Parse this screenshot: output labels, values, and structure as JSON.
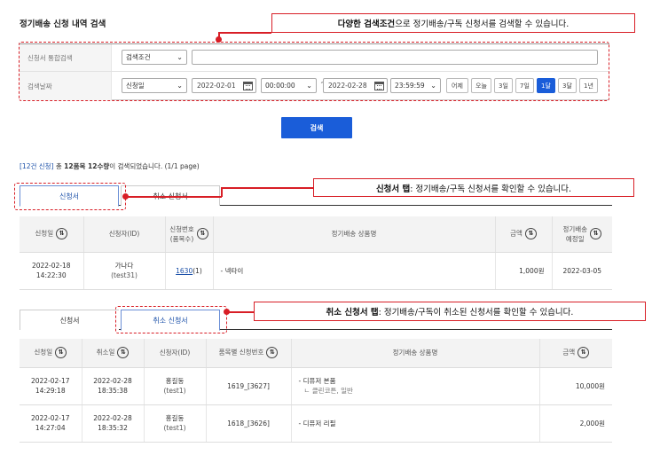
{
  "page_title": "정기배송 신청 내역 검색",
  "search": {
    "combined_label": "신청서 통합검색",
    "condition_select": "검색조건",
    "date_label": "검색날짜",
    "date_type_select": "신청일",
    "start_date": "2022-02-01",
    "start_time": "00:00:00",
    "tilde": "~",
    "end_date": "2022-02-28",
    "end_time": "23:59:59",
    "quick_ranges": [
      "어제",
      "오늘",
      "3일",
      "7일",
      "1달",
      "3달",
      "1년"
    ],
    "active_range": "1달",
    "button": "검색"
  },
  "callouts": {
    "search_bold": "다양한 검색조건",
    "search_rest": "으로 정기배송/구독 신청서를 검색할 수 있습니다.",
    "tab1_bold": "신청서 탭",
    "tab1_rest": " : 정기배송/구독 신청서를 확인할 수 있습니다.",
    "tab2_bold": "취소 신청서 탭",
    "tab2_rest": " : 정기배송/구독이 취소된 신청서를 확인할 수 있습니다."
  },
  "result": {
    "count": "[12건 신청]",
    "middle": " 총 ",
    "bold": "12품목 12수량",
    "rest": "이 검색되었습니다. (1/1 page)"
  },
  "tabs": {
    "orders": "신청서",
    "cancelled": "취소 신청서"
  },
  "orders_table": {
    "headers": {
      "date": "신청일",
      "applicant": "신청자(ID)",
      "number_l1": "신청번호",
      "number_l2": "(품목수)",
      "product": "정기배송 상품명",
      "amount": "금액",
      "scheduled_l1": "정기배송",
      "scheduled_l2": "예정일"
    },
    "rows": [
      {
        "date": "2022-02-18",
        "time": "14:22:30",
        "name": "가나다",
        "id": "(test31)",
        "number": "1630",
        "items": "(1)",
        "product": "- 넥타이",
        "amount": "1,000원",
        "scheduled": "2022-03-05"
      }
    ]
  },
  "cancel_table": {
    "headers": {
      "date": "신청일",
      "cancel_date": "취소일",
      "applicant": "신청자(ID)",
      "number": "품목별 신청번호",
      "product": "정기배송 상품명",
      "amount": "금액"
    },
    "rows": [
      {
        "date": "2022-02-17",
        "time": "14:29:18",
        "cancel_date": "2022-02-28",
        "cancel_time": "18:35:38",
        "name": "홍길동",
        "id": "(test1)",
        "number": "1619_[3627]",
        "product": "- 디퓨저 본품",
        "option": "ㄴ 클린코튼, 일반",
        "amount": "10,000원"
      },
      {
        "date": "2022-02-17",
        "time": "14:27:04",
        "cancel_date": "2022-02-28",
        "cancel_time": "18:35:32",
        "name": "홍길동",
        "id": "(test1)",
        "number": "1618_[3626]",
        "product": "- 디퓨저 리필",
        "amount": "2,000원"
      }
    ]
  },
  "icons": {
    "sort": "sort-updown-icon",
    "calendar": "calendar-icon",
    "chevron": "chevron-down-icon"
  },
  "colors": {
    "accent": "#1a5dd9",
    "highlight": "#d81e26"
  }
}
